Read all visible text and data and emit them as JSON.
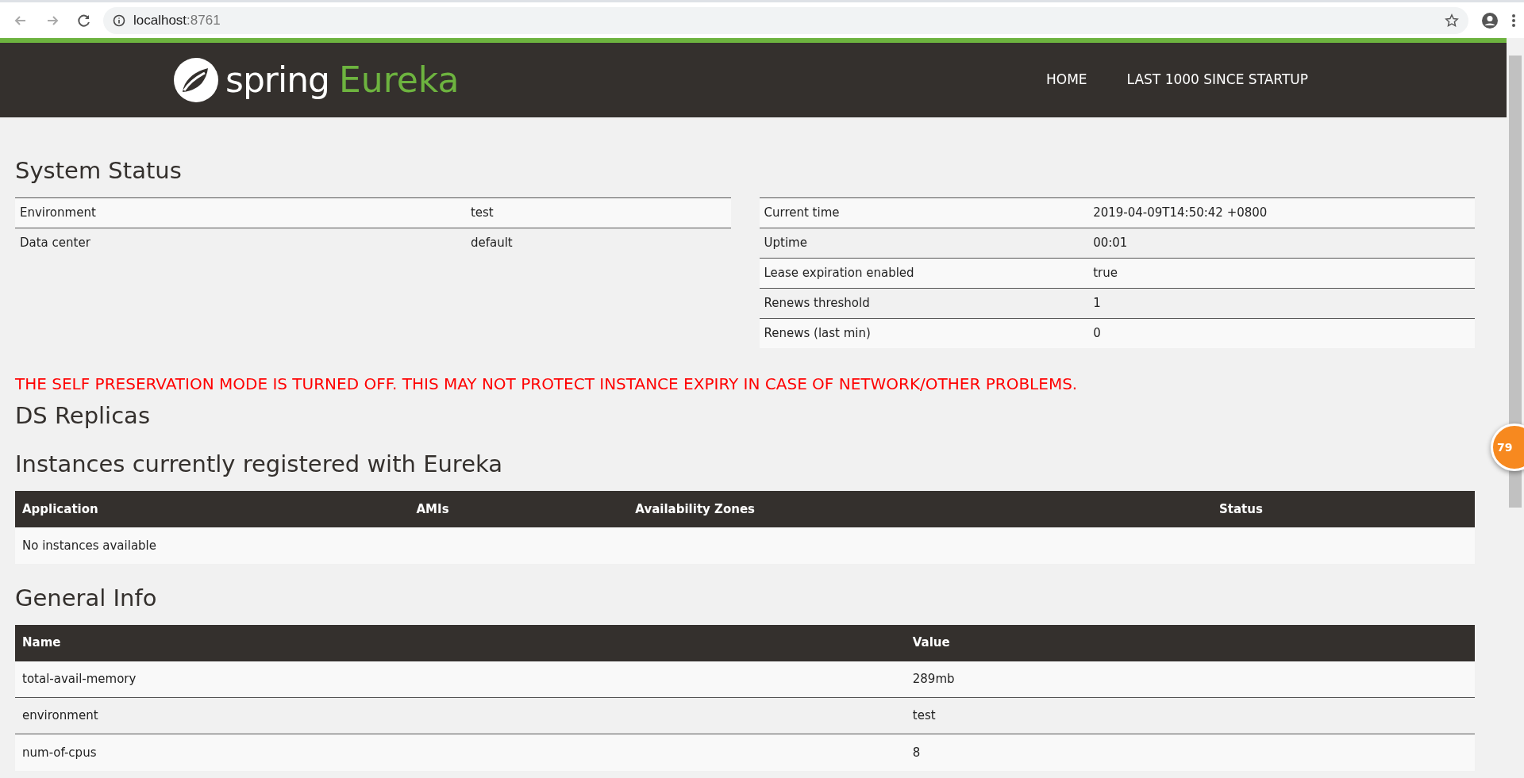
{
  "browser": {
    "host": "localhost",
    "port": ":8761"
  },
  "navbar": {
    "brand_word": "spring",
    "brand_product": "Eureka",
    "links": [
      {
        "label": "HOME"
      },
      {
        "label": "LAST 1000 SINCE STARTUP"
      }
    ]
  },
  "system_status": {
    "title": "System Status",
    "left_rows": [
      {
        "name": "Environment",
        "value": "test"
      },
      {
        "name": "Data center",
        "value": "default"
      }
    ],
    "right_rows": [
      {
        "name": "Current time",
        "value": "2019-04-09T14:50:42 +0800"
      },
      {
        "name": "Uptime",
        "value": "00:01"
      },
      {
        "name": "Lease expiration enabled",
        "value": "true"
      },
      {
        "name": "Renews threshold",
        "value": "1"
      },
      {
        "name": "Renews (last min)",
        "value": "0"
      }
    ]
  },
  "warning": "THE SELF PRESERVATION MODE IS TURNED OFF. THIS MAY NOT PROTECT INSTANCE EXPIRY IN CASE OF NETWORK/OTHER PROBLEMS.",
  "ds_replicas": {
    "title": "DS Replicas"
  },
  "instances": {
    "title": "Instances currently registered with Eureka",
    "columns": [
      "Application",
      "AMIs",
      "Availability Zones",
      "Status"
    ],
    "empty_text": "No instances available"
  },
  "general_info": {
    "title": "General Info",
    "columns": [
      "Name",
      "Value"
    ],
    "rows": [
      {
        "name": "total-avail-memory",
        "value": "289mb"
      },
      {
        "name": "environment",
        "value": "test"
      },
      {
        "name": "num-of-cpus",
        "value": "8"
      }
    ]
  },
  "floating_badge": {
    "count": "79"
  }
}
